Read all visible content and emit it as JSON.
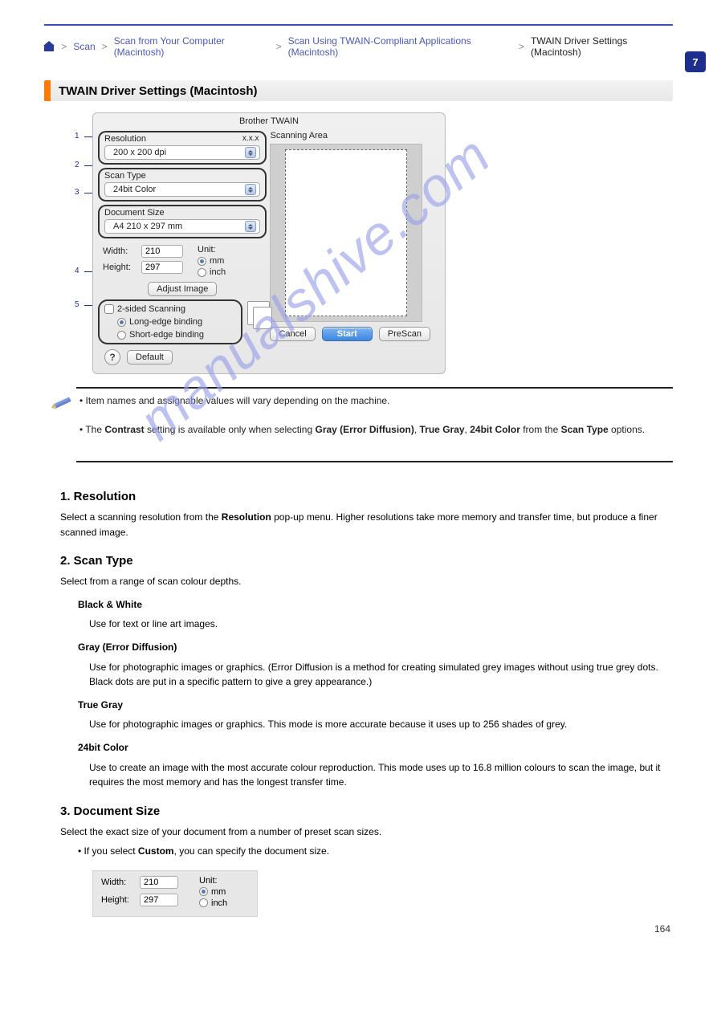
{
  "breadcrumb": {
    "home_aria": "Home",
    "scan": "Scan",
    "cat": "Scan from Your Computer (Macintosh)",
    "page_link": "Scan Using TWAIN-Compliant Applications (Macintosh)",
    "current": "TWAIN Driver Settings (Macintosh)"
  },
  "section_title": "TWAIN Driver Settings (Macintosh)",
  "dialog": {
    "title": "Brother TWAIN",
    "version": "x.x.x",
    "resolution_label": "Resolution",
    "resolution_value": "200 x 200 dpi",
    "scantype_label": "Scan Type",
    "scantype_value": "24bit Color",
    "docsize_label": "Document Size",
    "docsize_value": "A4  210 x 297 mm",
    "width_label": "Width:",
    "width_value": "210",
    "height_label": "Height:",
    "height_value": "297",
    "unit_label": "Unit:",
    "unit_mm": "mm",
    "unit_inch": "inch",
    "adjust_btn": "Adjust Image",
    "twosided_label": "2-sided Scanning",
    "long_edge": "Long-edge binding",
    "short_edge": "Short-edge binding",
    "default_btn": "Default",
    "cancel_btn": "Cancel",
    "start_btn": "Start",
    "prescan_btn": "PreScan",
    "scanarea_label": "Scanning Area"
  },
  "callouts": {
    "n1": "1",
    "n2": "2",
    "n3": "3",
    "n4": "4",
    "n5": "5"
  },
  "note": {
    "line1": "Item names and assignable values will vary depending on the machine.",
    "line2_a": "The ",
    "line2_b": "Contrast",
    "line2_c": " setting is available only when selecting ",
    "line2_d": "Gray (Error Diffusion)",
    "line2_e": ", ",
    "line2_f": "True Gray",
    "line2_g": ", ",
    "line2_h": "24bit Color",
    "line2_i": " from the ",
    "line2_j": "Scan Type",
    "line2_k": " options."
  },
  "items": {
    "res_title": "1. Resolution",
    "res_body_a": "Select a scanning resolution from the ",
    "res_body_b": "Resolution",
    "res_body_c": " pop-up menu. Higher resolutions take more memory and transfer time, but produce a finer scanned image.",
    "st_title": "2. Scan Type",
    "st_body": "Select from a range of scan colour depths.",
    "bw_title": "Black & White",
    "bw_body": "Use for text or line art images.",
    "gray_title": "Gray (Error Diffusion)",
    "gray_body": "Use for photographic images or graphics. (Error Diffusion is a method for creating simulated grey images without using true grey dots. Black dots are put in a specific pattern to give a grey appearance.)",
    "tg_title": "True Gray",
    "tg_body": "Use for photographic images or graphics. This mode is more accurate because it uses up to 256 shades of grey.",
    "c24_title": "24bit Color",
    "c24_body": "Use to create an image with the most accurate colour reproduction. This mode uses up to 16.8 million colours to scan the image, but it requires the most memory and has the longest transfer time.",
    "ds_title": "3. Document Size",
    "ds_body": "Select the exact size of your document from a number of preset scan sizes.",
    "ds_custom_a": "If you select ",
    "ds_custom_b": "Custom",
    "ds_custom_c": ", you can specify the document size."
  },
  "small_panel": {
    "width_label": "Width:",
    "width_value": "210",
    "height_label": "Height:",
    "height_value": "297",
    "unit_label": "Unit:",
    "unit_mm": "mm",
    "unit_inch": "inch"
  },
  "page_number": "164",
  "side_tab": "7",
  "watermark": "manualshive.com"
}
